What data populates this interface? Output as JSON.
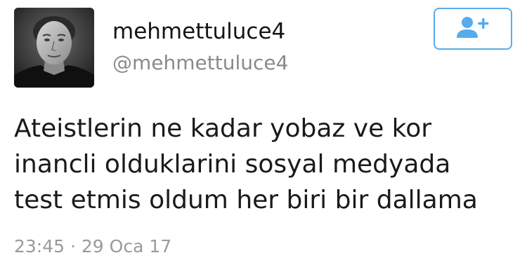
{
  "user": {
    "display_name": "mehmettuluce4",
    "handle": "@mehmettuluce4",
    "avatar_icon": "profile-photo"
  },
  "follow_button": {
    "icon": "add-user-icon",
    "color": "#55acee"
  },
  "tweet": {
    "lines": [
      "Ateistlerin ne kadar yobaz ve kor",
      "inancli olduklarini sosyal medyada",
      "test etmis oldum her biri bir dallama"
    ],
    "time": "23:45",
    "separator": "·",
    "date": "29 Oca 17"
  }
}
